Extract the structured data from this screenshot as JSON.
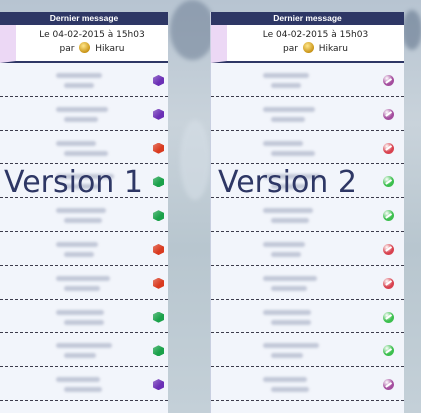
{
  "panels": [
    {
      "header": "Dernier message",
      "date_line": "Le 04-02-2015 à 15h03",
      "by_prefix": "par",
      "author": "Hikaru",
      "version_label": "Version 1",
      "rows": [
        {
          "icon": "purple-gem-icon",
          "color": "#6b2fb5"
        },
        {
          "icon": "purple-gem-icon",
          "color": "#6b2fb5"
        },
        {
          "icon": "red-gem-icon",
          "color": "#d93a1f"
        },
        {
          "icon": "green-gem-icon",
          "color": "#1aa14a"
        },
        {
          "icon": "green-gem-icon",
          "color": "#1aa14a"
        },
        {
          "icon": "red-gem-icon",
          "color": "#d93a1f"
        },
        {
          "icon": "red-gem-icon",
          "color": "#d93a1f"
        },
        {
          "icon": "green-gem-icon",
          "color": "#1aa14a"
        },
        {
          "icon": "green-gem-icon",
          "color": "#1aa14a"
        },
        {
          "icon": "purple-gem-icon",
          "color": "#6b2fb5"
        }
      ]
    },
    {
      "header": "Dernier message",
      "date_line": "Le 04-02-2015 à 15h03",
      "by_prefix": "par",
      "author": "Hikaru",
      "version_label": "Version 2",
      "rows": [
        {
          "icon": "purple-ball-icon",
          "color": "#a44d9e"
        },
        {
          "icon": "purple-ball-icon",
          "color": "#a44d9e"
        },
        {
          "icon": "red-ball-icon",
          "color": "#d8424f"
        },
        {
          "icon": "green-ball-icon",
          "color": "#3cbf4e"
        },
        {
          "icon": "green-ball-icon",
          "color": "#3cbf4e"
        },
        {
          "icon": "red-ball-icon",
          "color": "#d8424f"
        },
        {
          "icon": "red-ball-icon",
          "color": "#d8424f"
        },
        {
          "icon": "green-ball-icon",
          "color": "#3cbf4e"
        },
        {
          "icon": "green-ball-icon",
          "color": "#3cbf4e"
        },
        {
          "icon": "purple-ball-icon",
          "color": "#a44d9e"
        }
      ]
    }
  ]
}
